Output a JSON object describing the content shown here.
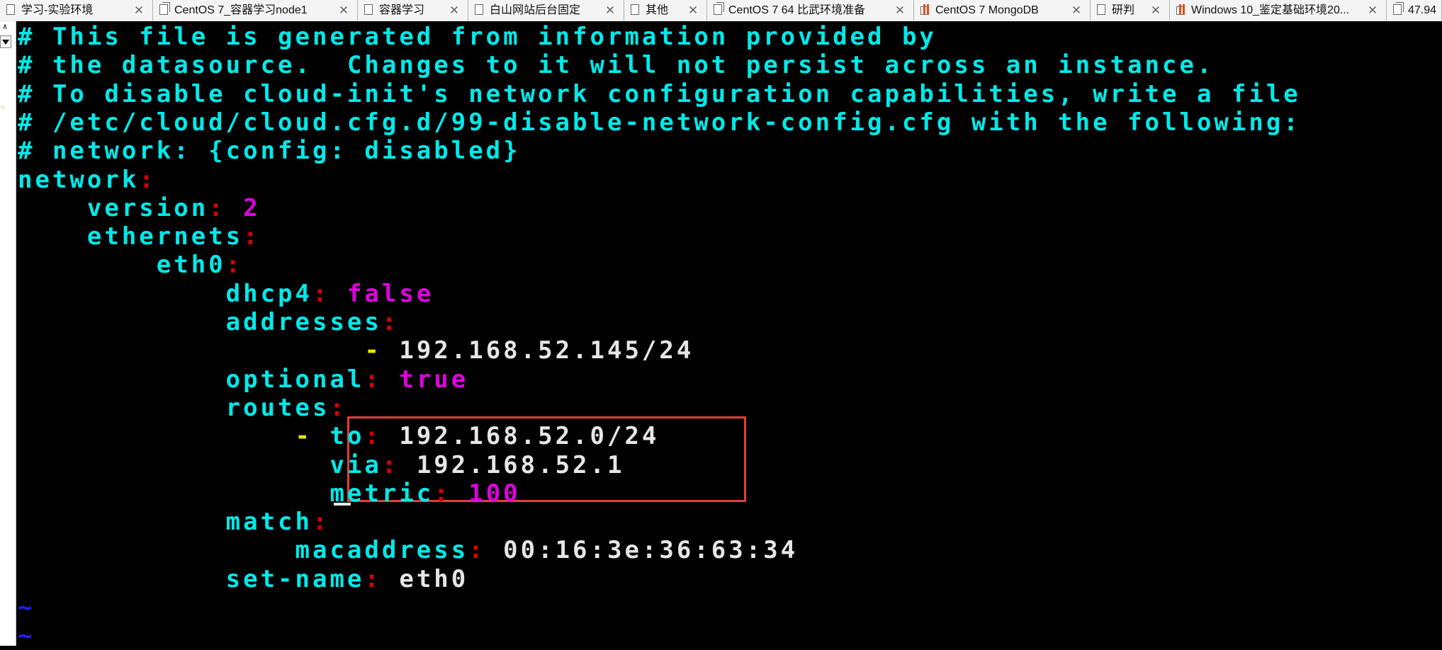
{
  "tabs": [
    {
      "label": "学习-实验环境",
      "icon": "document-icon"
    },
    {
      "label": "CentOS 7_容器学习node1",
      "icon": "copy-icon"
    },
    {
      "label": "容器学习",
      "icon": "document-icon"
    },
    {
      "label": "白山网站后台固定",
      "icon": "document-icon"
    },
    {
      "label": "其他",
      "icon": "document-icon"
    },
    {
      "label": "CentOS 7 64 比武环境准备",
      "icon": "copy-icon"
    },
    {
      "label": "CentOS 7 MongoDB",
      "icon": "chart-icon"
    },
    {
      "label": "研判",
      "icon": "document-icon"
    },
    {
      "label": "Windows 10_鉴定基础环境20...",
      "icon": "chart-icon"
    },
    {
      "label": "47.94",
      "icon": "copy-icon"
    }
  ],
  "close_glyph": "✕",
  "terminal": {
    "lines": [
      [
        {
          "t": "# This file is generated from information provided by",
          "c": "comment"
        }
      ],
      [
        {
          "t": "# the datasource.  Changes to it will not persist across an instance.",
          "c": "comment"
        }
      ],
      [
        {
          "t": "# To disable cloud-init's network configuration capabilities, write a file",
          "c": "comment"
        }
      ],
      [
        {
          "t": "# /etc/cloud/cloud.cfg.d/99-disable-network-config.cfg with the following:",
          "c": "comment"
        }
      ],
      [
        {
          "t": "# network: {config: disabled}",
          "c": "comment"
        }
      ],
      [
        {
          "t": "network",
          "c": "key"
        },
        {
          "t": ":",
          "c": "colon"
        }
      ],
      [
        {
          "t": "    version",
          "c": "key"
        },
        {
          "t": ":",
          "c": "colon"
        },
        {
          "t": " 2",
          "c": "magenta"
        }
      ],
      [
        {
          "t": "    ethernets",
          "c": "key"
        },
        {
          "t": ":",
          "c": "colon"
        }
      ],
      [
        {
          "t": "        eth0",
          "c": "key"
        },
        {
          "t": ":",
          "c": "colon"
        }
      ],
      [
        {
          "t": "            dhcp4",
          "c": "key"
        },
        {
          "t": ":",
          "c": "colon"
        },
        {
          "t": " false",
          "c": "magenta"
        }
      ],
      [
        {
          "t": "            addresses",
          "c": "key"
        },
        {
          "t": ":",
          "c": "colon"
        }
      ],
      [
        {
          "t": "                    -",
          "c": "yellow"
        },
        {
          "t": " 192.168.52.145/24",
          "c": "white"
        }
      ],
      [
        {
          "t": "            optional",
          "c": "key"
        },
        {
          "t": ":",
          "c": "colon"
        },
        {
          "t": " true",
          "c": "magenta"
        }
      ],
      [
        {
          "t": "            routes",
          "c": "key"
        },
        {
          "t": ":",
          "c": "colon"
        }
      ],
      [
        {
          "t": "                -",
          "c": "yellow"
        },
        {
          "t": " to",
          "c": "key"
        },
        {
          "t": ":",
          "c": "colon"
        },
        {
          "t": " 192.168.52.0/24",
          "c": "white"
        }
      ],
      [
        {
          "t": "                  via",
          "c": "key"
        },
        {
          "t": ":",
          "c": "colon"
        },
        {
          "t": " 192.168.52.1",
          "c": "white"
        }
      ],
      [
        {
          "t": "                  metric",
          "c": "key"
        },
        {
          "t": ":",
          "c": "colon"
        },
        {
          "t": " 100",
          "c": "magenta"
        }
      ],
      [
        {
          "t": "            match",
          "c": "key"
        },
        {
          "t": ":",
          "c": "colon"
        }
      ],
      [
        {
          "t": "                macaddress",
          "c": "key"
        },
        {
          "t": ":",
          "c": "colon"
        },
        {
          "t": " 00:16:3e:36:63:34",
          "c": "white"
        }
      ],
      [
        {
          "t": "            set-name",
          "c": "key"
        },
        {
          "t": ":",
          "c": "colon"
        },
        {
          "t": " eth0",
          "c": "white"
        }
      ],
      [
        {
          "t": "~",
          "c": "tilde"
        }
      ],
      [
        {
          "t": "~",
          "c": "tilde"
        }
      ]
    ]
  },
  "colors": {
    "background": "#000000",
    "comment": "#00eaea",
    "key": "#00eaea",
    "colon": "#d80000",
    "magenta": "#e000e0",
    "white": "#e6e6e6",
    "yellow": "#e6e600",
    "tilde": "#2020ff",
    "highlight_border": "#e43c3c"
  }
}
